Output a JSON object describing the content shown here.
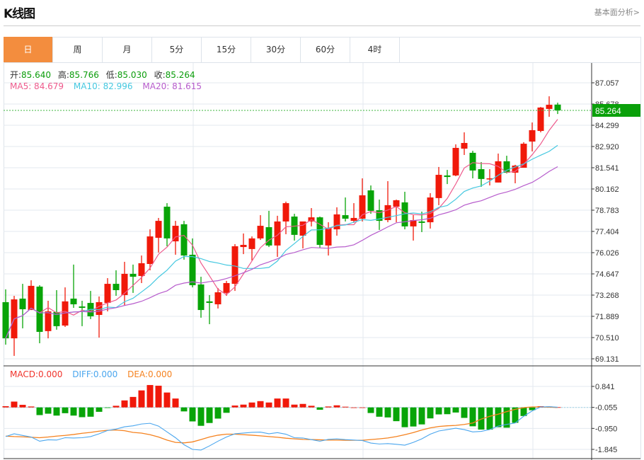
{
  "header": {
    "title": "K线图",
    "link": "基本面分析>"
  },
  "tabs": [
    {
      "label": "日",
      "active": true
    },
    {
      "label": "周"
    },
    {
      "label": "月"
    },
    {
      "label": "5分"
    },
    {
      "label": "15分"
    },
    {
      "label": "30分"
    },
    {
      "label": "60分"
    },
    {
      "label": "4时"
    }
  ],
  "info": {
    "open_label": "开:",
    "open": "85.640",
    "high_label": "高:",
    "high": "85.766",
    "low_label": "低:",
    "low": "85.030",
    "close_label": "收:",
    "close": "85.264"
  },
  "ma": {
    "ma5": "MA5: 84.679",
    "ma10": "MA10: 82.996",
    "ma20": "MA20: 81.615"
  },
  "macd_legend": {
    "macd": "MACD:0.000",
    "diff": "DIFF:0.000",
    "dea": "DEA:0.000"
  },
  "colors": {
    "up": "#f0190a",
    "down": "#08a408",
    "ma5": "#ee5a8c",
    "ma10": "#45c8e0",
    "ma20": "#b75ccc",
    "diff": "#4aa6ee",
    "dea": "#f5821f",
    "accent": "#f38d3e"
  },
  "chart_data": [
    {
      "type": "candlestick",
      "current_price": "85.264",
      "price_ticks": [
        "87.057",
        "85.678",
        "84.299",
        "82.920",
        "81.541",
        "80.162",
        "78.783",
        "77.404",
        "76.026",
        "74.647",
        "73.268",
        "71.889",
        "70.510",
        "69.131"
      ],
      "ylim": [
        69.131,
        87.057
      ],
      "ohlc": [
        [
          72.81,
          73.64,
          70.05,
          70.46
        ],
        [
          70.46,
          73.22,
          69.32,
          72.99
        ],
        [
          73.04,
          74.0,
          71.11,
          72.35
        ],
        [
          72.3,
          74.23,
          72.3,
          73.87
        ],
        [
          73.82,
          73.91,
          70.14,
          70.88
        ],
        [
          70.93,
          72.9,
          70.46,
          72.21
        ],
        [
          72.17,
          73.59,
          71.02,
          71.25
        ],
        [
          71.29,
          73.77,
          71.2,
          72.86
        ],
        [
          73.04,
          75.25,
          72.44,
          72.67
        ],
        [
          72.53,
          72.9,
          71.25,
          72.44
        ],
        [
          72.76,
          73.54,
          71.71,
          71.89
        ],
        [
          71.98,
          73.18,
          70.51,
          72.81
        ],
        [
          72.76,
          74.37,
          72.21,
          74.0
        ],
        [
          74.0,
          74.88,
          73.22,
          73.59
        ],
        [
          73.27,
          75.43,
          72.58,
          74.65
        ],
        [
          74.65,
          75.25,
          73.41,
          74.46
        ],
        [
          74.51,
          75.84,
          74.05,
          75.34
        ],
        [
          75.29,
          77.54,
          74.88,
          77.08
        ],
        [
          76.99,
          78.28,
          76.03,
          78.09
        ],
        [
          79.01,
          79.24,
          76.44,
          76.95
        ],
        [
          76.76,
          78.09,
          75.89,
          77.77
        ],
        [
          77.87,
          78.09,
          75.57,
          75.84
        ],
        [
          75.89,
          76.95,
          73.77,
          73.91
        ],
        [
          73.96,
          74.46,
          71.8,
          72.3
        ],
        [
          72.86,
          73.27,
          71.38,
          72.76
        ],
        [
          72.67,
          73.73,
          72.4,
          73.45
        ],
        [
          73.41,
          74.19,
          73.22,
          74.05
        ],
        [
          74.0,
          76.58,
          73.54,
          76.44
        ],
        [
          76.39,
          77.27,
          75.93,
          76.53
        ],
        [
          76.26,
          77.08,
          75.52,
          76.95
        ],
        [
          76.95,
          78.46,
          76.85,
          77.77
        ],
        [
          77.68,
          78.74,
          76.39,
          76.49
        ],
        [
          76.49,
          78.42,
          75.75,
          78.05
        ],
        [
          78.05,
          79.34,
          77.22,
          79.24
        ],
        [
          78.37,
          78.55,
          76.81,
          77.18
        ],
        [
          77.13,
          78.05,
          76.3,
          78.05
        ],
        [
          78.05,
          78.92,
          77.73,
          78.32
        ],
        [
          78.32,
          78.37,
          76.35,
          76.53
        ],
        [
          76.49,
          78.0,
          75.84,
          77.64
        ],
        [
          77.54,
          78.97,
          77.13,
          78.51
        ],
        [
          78.46,
          79.61,
          78.05,
          78.23
        ],
        [
          78.09,
          79.24,
          77.96,
          78.28
        ],
        [
          78.23,
          80.85,
          78.05,
          79.75
        ],
        [
          80.07,
          80.39,
          78.55,
          78.74
        ],
        [
          78.78,
          79.47,
          77.5,
          78.09
        ],
        [
          78.14,
          80.67,
          78.0,
          79.11
        ],
        [
          79.01,
          79.47,
          78.0,
          79.43
        ],
        [
          79.29,
          79.98,
          77.54,
          77.73
        ],
        [
          77.73,
          78.46,
          76.81,
          78.14
        ],
        [
          78.05,
          78.69,
          77.36,
          77.96
        ],
        [
          78.0,
          79.89,
          77.59,
          79.61
        ],
        [
          79.57,
          81.59,
          79.11,
          81.08
        ],
        [
          81.04,
          81.4,
          80.48,
          80.94
        ],
        [
          81.04,
          83.06,
          80.99,
          82.83
        ],
        [
          82.78,
          83.84,
          82.37,
          83.15
        ],
        [
          82.51,
          82.64,
          80.85,
          81.36
        ],
        [
          81.45,
          81.91,
          80.3,
          80.81
        ],
        [
          80.81,
          81.45,
          80.39,
          80.85
        ],
        [
          80.58,
          82.46,
          80.58,
          81.96
        ],
        [
          81.96,
          82.32,
          81.17,
          81.22
        ],
        [
          81.22,
          81.73,
          80.53,
          81.68
        ],
        [
          81.54,
          83.2,
          81.54,
          83.1
        ],
        [
          83.24,
          84.48,
          82.6,
          83.98
        ],
        [
          83.93,
          85.49,
          83.84,
          85.45
        ],
        [
          85.36,
          86.18,
          84.85,
          85.63
        ],
        [
          85.64,
          85.766,
          85.03,
          85.264
        ]
      ]
    },
    {
      "type": "macd",
      "ticks": [
        "0.841",
        "-0.055",
        "-0.950",
        "-1.845"
      ],
      "ylim": [
        -1.845,
        0.841
      ],
      "baseline": -0.055,
      "histogram": [
        -0.004,
        0.193,
        0.055,
        -0.016,
        -0.383,
        -0.323,
        -0.404,
        -0.302,
        -0.404,
        -0.472,
        -0.452,
        -0.243,
        -0.076,
        0.014,
        0.243,
        0.392,
        0.67,
        0.899,
        0.87,
        0.58,
        0.324,
        -0.225,
        -0.652,
        -0.84,
        -0.72,
        -0.532,
        -0.285,
        0.025,
        0.064,
        0.154,
        0.213,
        0.154,
        0.324,
        0.324,
        0.064,
        0.094,
        0.014,
        -0.154,
        -0.016,
        0.034,
        -0.025,
        -0.055,
        -0.055,
        -0.294,
        -0.452,
        -0.482,
        -0.642,
        -0.899,
        -0.869,
        -0.78,
        -0.523,
        -0.353,
        -0.344,
        -0.273,
        -0.502,
        -0.86,
        -1.0,
        -1.0,
        -0.899,
        -0.92,
        -0.711,
        -0.422,
        -0.174,
        -0.004,
        -0.016,
        -0.046
      ],
      "diff": [
        -1.299,
        -1.18,
        -1.25,
        -1.317,
        -1.496,
        -1.436,
        -1.448,
        -1.347,
        -1.359,
        -1.347,
        -1.299,
        -1.18,
        -1.039,
        -0.98,
        -0.881,
        -0.84,
        -0.762,
        -0.732,
        -0.851,
        -1.099,
        -1.347,
        -1.645,
        -1.845,
        -1.875,
        -1.696,
        -1.496,
        -1.317,
        -1.18,
        -1.15,
        -1.12,
        -1.108,
        -1.18,
        -1.129,
        -1.197,
        -1.347,
        -1.359,
        -1.427,
        -1.496,
        -1.418,
        -1.397,
        -1.427,
        -1.448,
        -1.466,
        -1.576,
        -1.615,
        -1.597,
        -1.627,
        -1.666,
        -1.547,
        -1.397,
        -1.197,
        -1.06,
        -1.001,
        -0.941,
        -1.001,
        -1.099,
        -1.078,
        -1.001,
        -0.851,
        -0.78,
        -0.72,
        -0.434,
        -0.204,
        -0.034,
        -0.025,
        -0.046
      ],
      "dea": [
        -1.278,
        -1.299,
        -1.31,
        -1.329,
        -1.347,
        -1.317,
        -1.278,
        -1.248,
        -1.209,
        -1.159,
        -1.12,
        -1.069,
        -1.03,
        -1.019,
        -1.048,
        -1.12,
        -1.15,
        -1.218,
        -1.317,
        -1.448,
        -1.547,
        -1.567,
        -1.526,
        -1.427,
        -1.317,
        -1.239,
        -1.197,
        -1.197,
        -1.218,
        -1.239,
        -1.269,
        -1.299,
        -1.329,
        -1.368,
        -1.397,
        -1.418,
        -1.427,
        -1.436,
        -1.448,
        -1.448,
        -1.457,
        -1.457,
        -1.457,
        -1.427,
        -1.397,
        -1.359,
        -1.299,
        -1.218,
        -1.129,
        -1.019,
        -0.929,
        -0.869,
        -0.84,
        -0.822,
        -0.78,
        -0.72,
        -0.553,
        -0.434,
        -0.344,
        -0.234,
        -0.136,
        -0.064,
        -0.034,
        -0.034,
        -0.046,
        -0.055
      ]
    }
  ]
}
